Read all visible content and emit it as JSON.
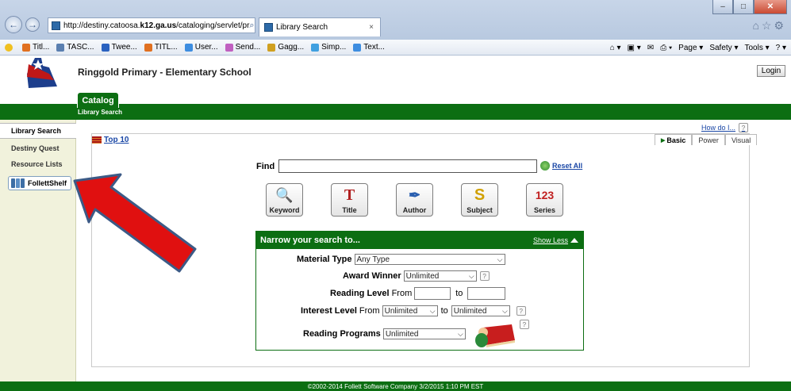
{
  "browser": {
    "url_prefix": "http://destiny.catoosa.",
    "url_bold": "k12.ga.us",
    "url_suffix": "/cataloging/servlet/pr",
    "tab_title": "Library Search",
    "favorites": [
      "Titl...",
      "TASC...",
      "Twee...",
      "TITL...",
      "User...",
      "Send...",
      "Gagg...",
      "Simp...",
      "Text..."
    ],
    "commands": [
      "Page ▾",
      "Safety ▾",
      "Tools ▾"
    ]
  },
  "header": {
    "school": "Ringgold Primary - Elementary School",
    "login": "Login"
  },
  "nav": {
    "catalog_tab": "Catalog",
    "sub_label": "Library Search"
  },
  "sidebar": {
    "items": [
      "Library Search",
      "Destiny Quest",
      "Resource Lists"
    ],
    "follett": "FollettShelf"
  },
  "main": {
    "top10": "Top 10",
    "howdo": "How do I...",
    "modes": [
      "Basic",
      "Power",
      "Visual"
    ],
    "find_label": "Find",
    "find_value": "",
    "reset": "Reset All",
    "search_buttons": [
      "Keyword",
      "Title",
      "Author",
      "Subject",
      "Series"
    ]
  },
  "narrow": {
    "title": "Narrow your search to...",
    "show_less": "Show Less",
    "material_type_label": "Material Type",
    "material_type_value": "Any Type",
    "award_label": "Award Winner",
    "award_value": "Unlimited",
    "reading_level_label": "Reading Level",
    "from_label": "From",
    "to_label": "to",
    "interest_label": "Interest Level",
    "interest_from": "Unlimited",
    "interest_to": "Unlimited",
    "programs_label": "Reading Programs",
    "programs_value": "Unlimited",
    "help": "?"
  },
  "footer": {
    "text": "©2002-2014 Follett Software Company     3/2/2015 1:10 PM EST"
  },
  "colors": {
    "brand_green": "#0c6e12",
    "link_blue": "#1a47a6",
    "sidebar_bg": "#f1f2dc",
    "arrow_red": "#e01010"
  }
}
